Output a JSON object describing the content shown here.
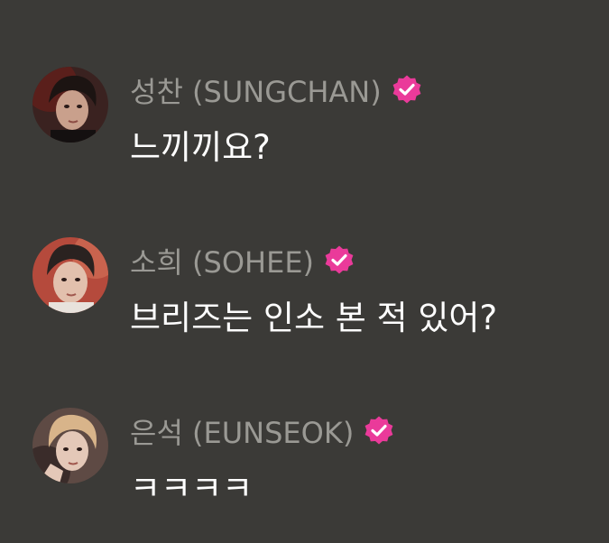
{
  "theme": {
    "background": "#3b3a37",
    "name_color": "#9a9994",
    "text_color": "#ffffff",
    "badge_color": "#ea3a9a"
  },
  "messages": [
    {
      "sender": "성찬 (SUNGCHAN)",
      "verified_icon": "verified-badge-icon",
      "text": "느끼끼요?"
    },
    {
      "sender": "소희 (SOHEE)",
      "verified_icon": "verified-badge-icon",
      "text": "브리즈는 인소 본 적 있어?"
    },
    {
      "sender": "은석 (EUNSEOK)",
      "verified_icon": "verified-badge-icon",
      "text": "ㅋㅋㅋㅋ"
    }
  ]
}
